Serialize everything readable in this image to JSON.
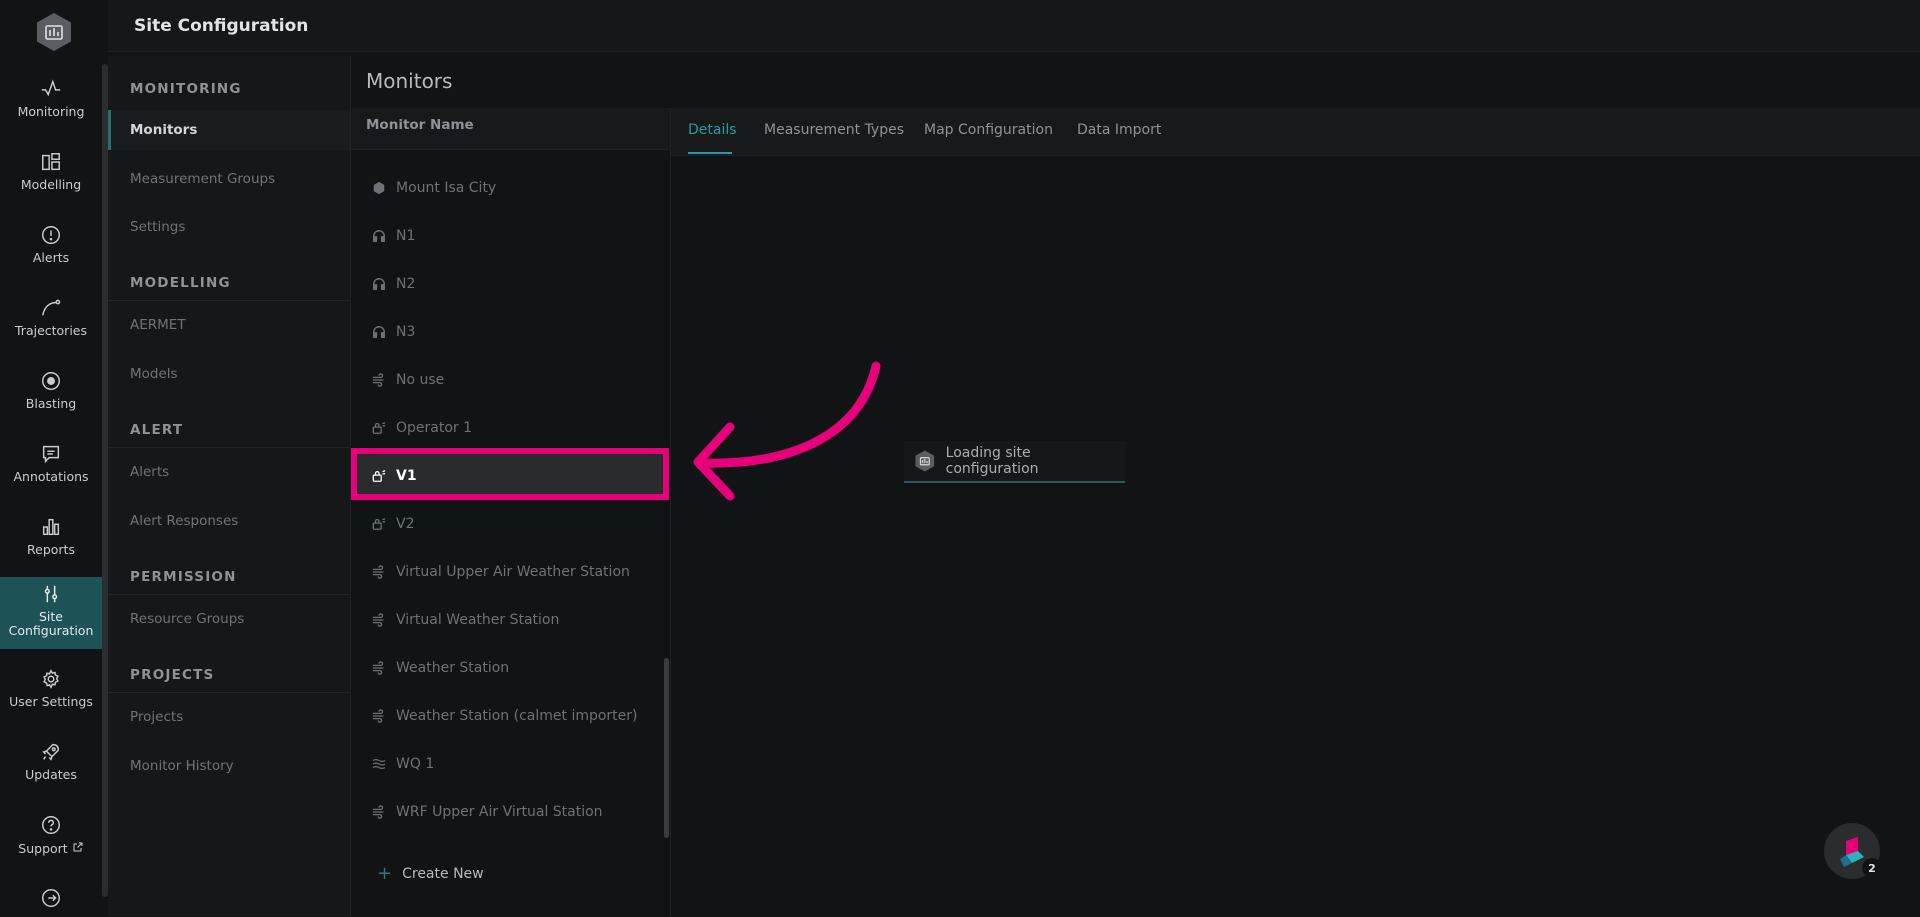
{
  "header": {
    "title": "Site Configuration"
  },
  "rail": {
    "items": [
      {
        "label": "Monitoring",
        "icon": "pulse-icon"
      },
      {
        "label": "Modelling",
        "icon": "layout-icon"
      },
      {
        "label": "Alerts",
        "icon": "alert-circle-icon"
      },
      {
        "label": "Trajectories",
        "icon": "trajectory-icon"
      },
      {
        "label": "Blasting",
        "icon": "target-icon"
      },
      {
        "label": "Annotations",
        "icon": "comment-icon"
      },
      {
        "label": "Reports",
        "icon": "bar-chart-icon"
      },
      {
        "label": "Site Configuration",
        "icon": "sliders-icon"
      },
      {
        "label": "User Settings",
        "icon": "gear-icon"
      },
      {
        "label": "Updates",
        "icon": "rocket-icon"
      },
      {
        "label": "Support",
        "icon": "help-circle-icon"
      },
      {
        "label": "",
        "icon": "logout-icon"
      }
    ]
  },
  "subnav": {
    "sections": [
      {
        "heading": "MONITORING",
        "items": [
          "Monitors",
          "Measurement Groups",
          "Settings"
        ]
      },
      {
        "heading": "MODELLING",
        "items": [
          "AERMET",
          "Models"
        ]
      },
      {
        "heading": "ALERT",
        "items": [
          "Alerts",
          "Alert Responses"
        ]
      },
      {
        "heading": "PERMISSION",
        "items": [
          "Resource Groups"
        ]
      },
      {
        "heading": "PROJECTS",
        "items": [
          "Projects",
          "Monitor History"
        ]
      }
    ]
  },
  "monitors": {
    "title": "Monitors",
    "column_header": "Monitor Name",
    "items": [
      {
        "name": "Mount Isa City",
        "icon": "cube-icon"
      },
      {
        "name": "N1",
        "icon": "headphones-icon"
      },
      {
        "name": "N2",
        "icon": "headphones-icon"
      },
      {
        "name": "N3",
        "icon": "headphones-icon"
      },
      {
        "name": "No use",
        "icon": "wind-icon"
      },
      {
        "name": "Operator 1",
        "icon": "vibration-icon"
      },
      {
        "name": "V1",
        "icon": "vibration-icon"
      },
      {
        "name": "V2",
        "icon": "vibration-icon"
      },
      {
        "name": "Virtual Upper Air Weather Station",
        "icon": "wind-icon"
      },
      {
        "name": "Virtual Weather Station",
        "icon": "wind-icon"
      },
      {
        "name": "Weather Station",
        "icon": "wind-icon"
      },
      {
        "name": "Weather Station (calmet importer)",
        "icon": "wind-icon"
      },
      {
        "name": "WQ 1",
        "icon": "water-icon"
      },
      {
        "name": "WRF Upper Air Virtual Station",
        "icon": "wind-icon"
      }
    ],
    "selected": "V1",
    "create_new": "Create New"
  },
  "tabs": [
    "Details",
    "Measurement Types",
    "Map Configuration",
    "Data Import"
  ],
  "loading": {
    "text": "Loading site configuration"
  },
  "help": {
    "badge": "2"
  },
  "colors": {
    "accent": "#2e9aa0",
    "highlight": "#e6007a",
    "active_rail": "#1d5256"
  }
}
